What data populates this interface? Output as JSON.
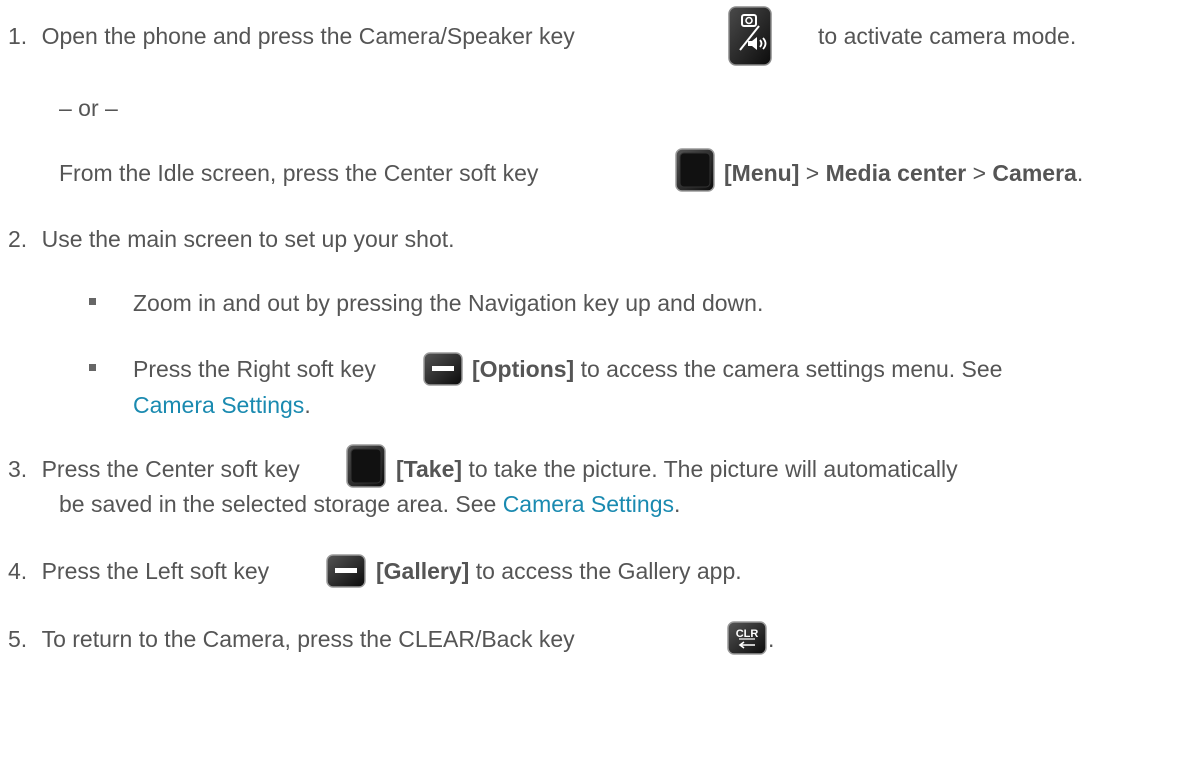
{
  "steps": {
    "s1": {
      "num": "1.",
      "a": "Open the phone and press the Camera/Speaker key",
      "b": "to activate camera mode.",
      "or": "– or –",
      "alt_a": "From the Idle screen, press the Center soft key",
      "alt_menu": "[Menu]",
      "alt_gt1": ">",
      "alt_media": "Media center",
      "alt_gt2": ">",
      "alt_camera": "Camera",
      "alt_end": "."
    },
    "s2": {
      "num": "2.",
      "text": "Use the main screen to set up your shot.",
      "bullet1": "Zoom in and out by pressing the Navigation key up and down.",
      "bullet2_a": "Press the Right soft key",
      "bullet2_key": "[Options]",
      "bullet2_b": "to access the camera settings menu. See",
      "bullet2_link": "Camera Settings",
      "bullet2_end": "."
    },
    "s3": {
      "num": "3.",
      "a": "Press the Center soft key",
      "key": "[Take]",
      "b": "to take the picture. The picture will automatically",
      "c": "be saved in the selected storage area. See",
      "link": "Camera Settings",
      "end": "."
    },
    "s4": {
      "num": "4.",
      "a": "Press the Left soft key",
      "key": "[Gallery]",
      "b": "to access the Gallery app."
    },
    "s5": {
      "num": "5.",
      "a": "To return to the Camera, press the CLEAR/Back key",
      "clr_label": "CLR",
      "end": "."
    }
  },
  "icons": [
    "camera-speaker-key-icon",
    "center-soft-key-icon",
    "right-soft-key-icon",
    "left-soft-key-icon",
    "clear-back-key-icon"
  ]
}
